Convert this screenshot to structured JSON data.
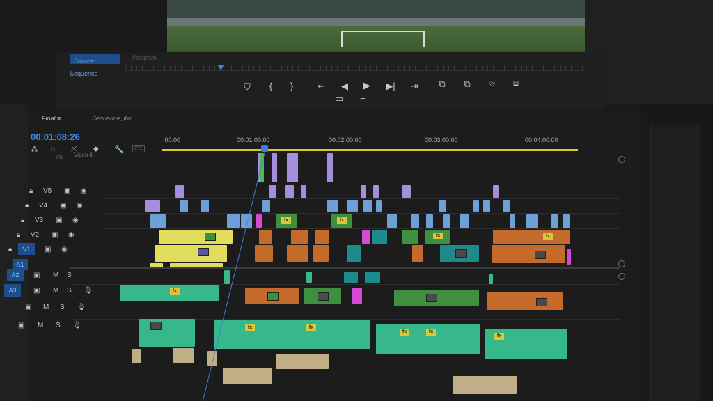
{
  "monitor": {
    "tab_active": "Source: Sequence",
    "tab_inactive": "Program"
  },
  "transport": {
    "buttons": [
      "⛉",
      "{",
      "}",
      "⇤",
      "◀",
      "▶",
      "▶|",
      "⇥",
      "⧉",
      "⧉",
      "⌾",
      "⧈"
    ],
    "row2": [
      "▭",
      "⌐"
    ]
  },
  "timeline": {
    "tabs": [
      "Final ≡",
      "Sequence_itw"
    ],
    "timecode": "00:01:08:26",
    "ruler": [
      ":00:00",
      "00:01:00:00",
      "00:02:00:00",
      "00:03:00:00",
      "00:04:00:00"
    ],
    "v6_label": "V6",
    "video6_label": "Video 6",
    "video_tracks": [
      "V5",
      "V4",
      "V3",
      "V2",
      "V1"
    ],
    "audio_tracks": [
      "A1",
      "A2",
      "A3"
    ],
    "audio_buttons": {
      "m": "M",
      "s": "S"
    }
  },
  "colors": {
    "lavender": "#a58fdc",
    "blue": "#6f9fd8",
    "yellow": "#e2dc5c",
    "orange": "#c46a2a",
    "teal": "#1e8a8a",
    "green": "#3e8f3e",
    "pink": "#d54ad5",
    "audio": "#36b88a",
    "tan": "#bfae86"
  }
}
